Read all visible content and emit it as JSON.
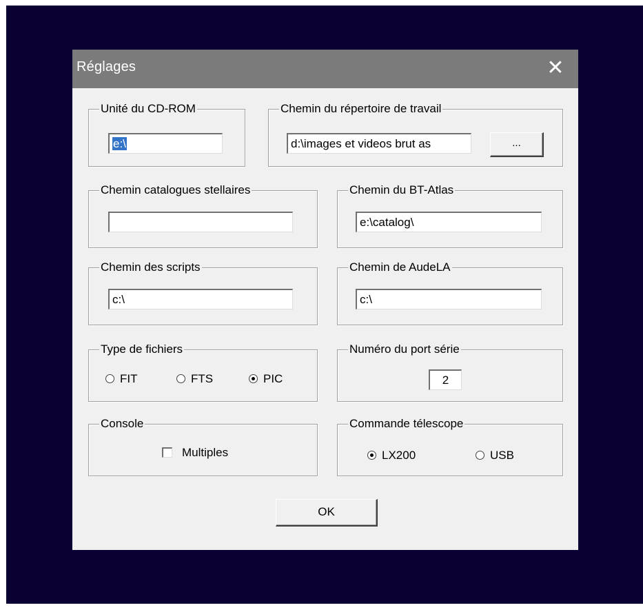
{
  "dialog": {
    "title": "Réglages",
    "close_glyph": "✕"
  },
  "cdrom": {
    "label": "Unité du CD-ROM",
    "value": "e:\\"
  },
  "workdir": {
    "label": "Chemin du répertoire de travail",
    "value": "d:\\images et videos brut as",
    "browse_label": "..."
  },
  "catalogues": {
    "label": "Chemin catalogues stellaires",
    "value": ""
  },
  "btatlas": {
    "label": "Chemin du BT-Atlas",
    "value": "e:\\catalog\\"
  },
  "scripts": {
    "label": "Chemin des scripts",
    "value": "c:\\"
  },
  "audela": {
    "label": "Chemin de AudeLA",
    "value": "c:\\"
  },
  "filetype": {
    "label": "Type de fichiers",
    "options": [
      "FIT",
      "FTS",
      "PIC"
    ],
    "selected": "PIC"
  },
  "serial": {
    "label": "Numéro du port série",
    "value": "2"
  },
  "console": {
    "label": "Console",
    "checkbox_label": "Multiples",
    "checked": false
  },
  "telescope": {
    "label": "Commande télescope",
    "options": [
      "LX200",
      "USB"
    ],
    "selected": "LX200"
  },
  "ok_label": "OK",
  "colors": {
    "desktop": "#0b0033",
    "titlebar": "#7b7b7b",
    "dialog": "#f0f0f0",
    "selection": "#3374c9"
  }
}
